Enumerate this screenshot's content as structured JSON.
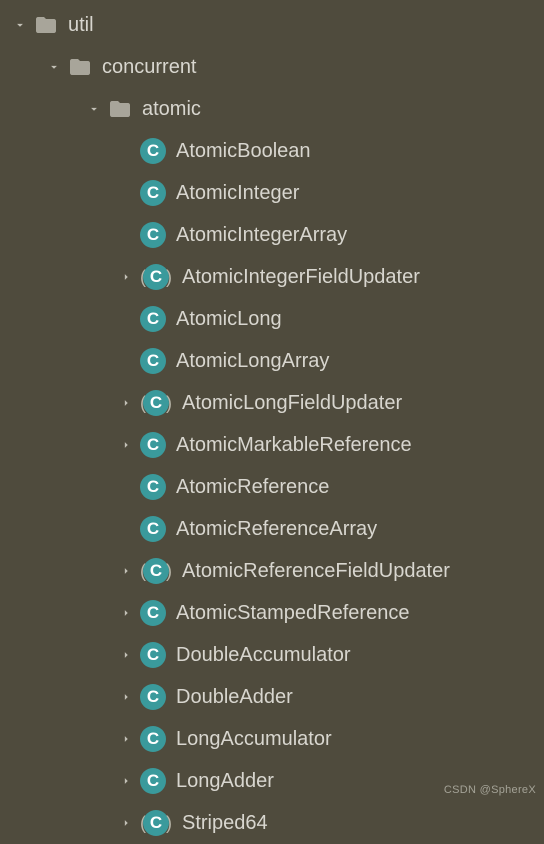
{
  "tree": {
    "root": {
      "label": "util",
      "children": [
        {
          "label": "concurrent",
          "children": [
            {
              "label": "atomic",
              "items": [
                {
                  "name": "AtomicBoolean",
                  "expandable": false,
                  "abstract": false
                },
                {
                  "name": "AtomicInteger",
                  "expandable": false,
                  "abstract": false
                },
                {
                  "name": "AtomicIntegerArray",
                  "expandable": false,
                  "abstract": false
                },
                {
                  "name": "AtomicIntegerFieldUpdater",
                  "expandable": true,
                  "abstract": true
                },
                {
                  "name": "AtomicLong",
                  "expandable": false,
                  "abstract": false
                },
                {
                  "name": "AtomicLongArray",
                  "expandable": false,
                  "abstract": false
                },
                {
                  "name": "AtomicLongFieldUpdater",
                  "expandable": true,
                  "abstract": true
                },
                {
                  "name": "AtomicMarkableReference",
                  "expandable": true,
                  "abstract": false
                },
                {
                  "name": "AtomicReference",
                  "expandable": false,
                  "abstract": false
                },
                {
                  "name": "AtomicReferenceArray",
                  "expandable": false,
                  "abstract": false
                },
                {
                  "name": "AtomicReferenceFieldUpdater",
                  "expandable": true,
                  "abstract": true
                },
                {
                  "name": "AtomicStampedReference",
                  "expandable": true,
                  "abstract": false
                },
                {
                  "name": "DoubleAccumulator",
                  "expandable": true,
                  "abstract": false
                },
                {
                  "name": "DoubleAdder",
                  "expandable": true,
                  "abstract": false
                },
                {
                  "name": "LongAccumulator",
                  "expandable": true,
                  "abstract": false
                },
                {
                  "name": "LongAdder",
                  "expandable": true,
                  "abstract": false
                },
                {
                  "name": "Striped64",
                  "expandable": true,
                  "abstract": true
                }
              ]
            }
          ]
        }
      ]
    }
  },
  "class_letter": "C",
  "watermark": "CSDN @SphereX"
}
